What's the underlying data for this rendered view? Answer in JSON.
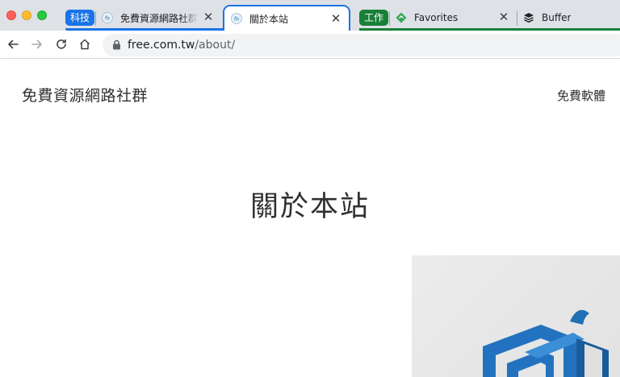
{
  "browser": {
    "tab_groups": [
      {
        "label": "科技",
        "color": "#1a73e8"
      },
      {
        "label": "工作",
        "color": "#188038"
      }
    ],
    "tabs": [
      {
        "title": "免費資源網路社群 – 免",
        "close": "✕"
      },
      {
        "title": "關於本站",
        "close": "✕"
      },
      {
        "title": "Favorites",
        "close": "✕"
      },
      {
        "title": "Buffer"
      }
    ],
    "address": {
      "domain": "free.com.tw",
      "path": "/about/"
    }
  },
  "site": {
    "title": "免費資源網路社群",
    "menu": [
      "免費軟體"
    ]
  },
  "page": {
    "heading": "關於本站"
  },
  "colors": {
    "accent": "#1a73e8",
    "work_group": "#188038",
    "logo_blue": "#1f6fb4"
  }
}
